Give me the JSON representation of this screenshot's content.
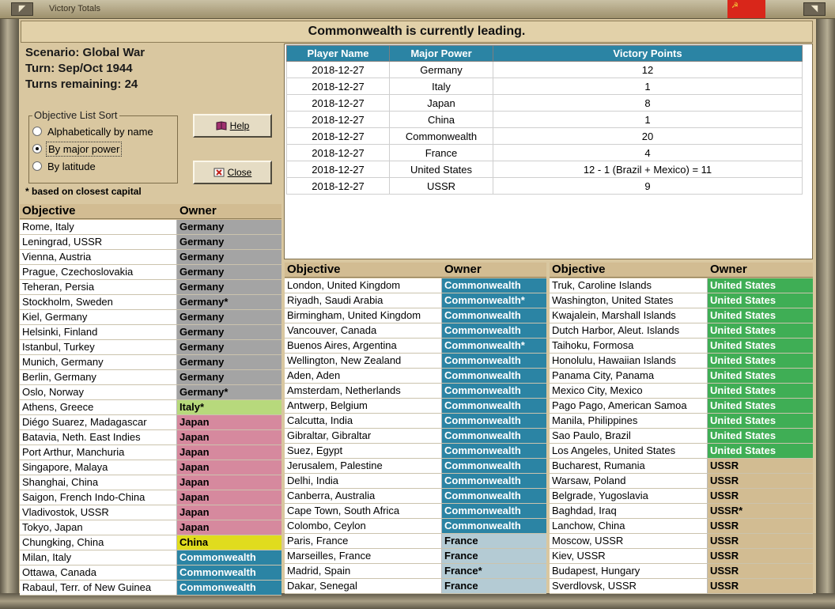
{
  "window": {
    "title": "Victory Totals"
  },
  "header": {
    "text": "Commonwealth is currently leading."
  },
  "info": {
    "scenario": "Scenario: Global War",
    "turn": "Turn: Sep/Oct 1944",
    "turns_remaining": "Turns remaining: 24"
  },
  "sort": {
    "legend": "Objective List Sort",
    "options": [
      "Alphabetically by name",
      "By major power",
      "By latitude"
    ],
    "selected_index": 1
  },
  "buttons": {
    "help": "Help",
    "close": "Close"
  },
  "footnote": "* based on closest capital",
  "vp_table": {
    "headers": [
      "Player Name",
      "Major Power",
      "Victory Points"
    ],
    "rows": [
      [
        "2018-12-27",
        "Germany",
        "12"
      ],
      [
        "2018-12-27",
        "Italy",
        "1"
      ],
      [
        "2018-12-27",
        "Japan",
        "8"
      ],
      [
        "2018-12-27",
        "China",
        "1"
      ],
      [
        "2018-12-27",
        "Commonwealth",
        "20"
      ],
      [
        "2018-12-27",
        "France",
        "4"
      ],
      [
        "2018-12-27",
        "United States",
        "12 - 1 (Brazil + Mexico) = 11"
      ],
      [
        "2018-12-27",
        "USSR",
        "9"
      ]
    ]
  },
  "colors": {
    "Germany": "#a4a4a4",
    "Italy": "#b7d97c",
    "Japan": "#d6899e",
    "China": "#e0dc1e",
    "Commonwealth": "#2b84a4",
    "France": "#b4cbd4",
    "United States": "#3fae55",
    "USSR": "#d2bc92"
  },
  "lists": {
    "headers": {
      "objective": "Objective",
      "owner": "Owner"
    },
    "col1": [
      [
        "Rome, Italy",
        "Germany",
        "Germany"
      ],
      [
        "Leningrad, USSR",
        "Germany",
        "Germany"
      ],
      [
        "Vienna, Austria",
        "Germany",
        "Germany"
      ],
      [
        "Prague, Czechoslovakia",
        "Germany",
        "Germany"
      ],
      [
        "Teheran, Persia",
        "Germany",
        "Germany"
      ],
      [
        "Stockholm, Sweden",
        "Germany*",
        "Germany"
      ],
      [
        "Kiel, Germany",
        "Germany",
        "Germany"
      ],
      [
        "Helsinki, Finland",
        "Germany",
        "Germany"
      ],
      [
        "Istanbul, Turkey",
        "Germany",
        "Germany"
      ],
      [
        "Munich, Germany",
        "Germany",
        "Germany"
      ],
      [
        "Berlin, Germany",
        "Germany",
        "Germany"
      ],
      [
        "Oslo, Norway",
        "Germany*",
        "Germany"
      ],
      [
        "Athens, Greece",
        "Italy*",
        "Italy"
      ],
      [
        "Diégo Suarez, Madagascar",
        "Japan",
        "Japan"
      ],
      [
        "Batavia, Neth. East Indies",
        "Japan",
        "Japan"
      ],
      [
        "Port Arthur, Manchuria",
        "Japan",
        "Japan"
      ],
      [
        "Singapore, Malaya",
        "Japan",
        "Japan"
      ],
      [
        "Shanghai, China",
        "Japan",
        "Japan"
      ],
      [
        "Saigon, French Indo-China",
        "Japan",
        "Japan"
      ],
      [
        "Vladivostok, USSR",
        "Japan",
        "Japan"
      ],
      [
        "Tokyo, Japan",
        "Japan",
        "Japan"
      ],
      [
        "Chungking, China",
        "China",
        "China"
      ],
      [
        "Milan, Italy",
        "Commonwealth",
        "Commonwealth"
      ],
      [
        "Ottawa, Canada",
        "Commonwealth",
        "Commonwealth"
      ],
      [
        "Rabaul, Terr. of New Guinea",
        "Commonwealth",
        "Commonwealth"
      ]
    ],
    "col2": [
      [
        "London, United Kingdom",
        "Commonwealth",
        "Commonwealth"
      ],
      [
        "Riyadh, Saudi Arabia",
        "Commonwealth*",
        "Commonwealth"
      ],
      [
        "Birmingham, United Kingdom",
        "Commonwealth",
        "Commonwealth"
      ],
      [
        "Vancouver, Canada",
        "Commonwealth",
        "Commonwealth"
      ],
      [
        "Buenos Aires, Argentina",
        "Commonwealth*",
        "Commonwealth"
      ],
      [
        "Wellington, New Zealand",
        "Commonwealth",
        "Commonwealth"
      ],
      [
        "Aden, Aden",
        "Commonwealth",
        "Commonwealth"
      ],
      [
        "Amsterdam, Netherlands",
        "Commonwealth",
        "Commonwealth"
      ],
      [
        "Antwerp, Belgium",
        "Commonwealth",
        "Commonwealth"
      ],
      [
        "Calcutta, India",
        "Commonwealth",
        "Commonwealth"
      ],
      [
        "Gibraltar, Gibraltar",
        "Commonwealth",
        "Commonwealth"
      ],
      [
        "Suez, Egypt",
        "Commonwealth",
        "Commonwealth"
      ],
      [
        "Jerusalem, Palestine",
        "Commonwealth",
        "Commonwealth"
      ],
      [
        "Delhi, India",
        "Commonwealth",
        "Commonwealth"
      ],
      [
        "Canberra, Australia",
        "Commonwealth",
        "Commonwealth"
      ],
      [
        "Cape Town, South Africa",
        "Commonwealth",
        "Commonwealth"
      ],
      [
        "Colombo, Ceylon",
        "Commonwealth",
        "Commonwealth"
      ],
      [
        "Paris, France",
        "France",
        "France"
      ],
      [
        "Marseilles, France",
        "France",
        "France"
      ],
      [
        "Madrid, Spain",
        "France*",
        "France"
      ],
      [
        "Dakar, Senegal",
        "France",
        "France"
      ]
    ],
    "col3": [
      [
        "Truk, Caroline Islands",
        "United States",
        "United States"
      ],
      [
        "Washington, United States",
        "United States",
        "United States"
      ],
      [
        "Kwajalein, Marshall Islands",
        "United States",
        "United States"
      ],
      [
        "Dutch Harbor, Aleut. Islands",
        "United States",
        "United States"
      ],
      [
        "Taihoku, Formosa",
        "United States",
        "United States"
      ],
      [
        "Honolulu, Hawaiian Islands",
        "United States",
        "United States"
      ],
      [
        "Panama City, Panama",
        "United States",
        "United States"
      ],
      [
        "Mexico City, Mexico",
        "United States",
        "United States"
      ],
      [
        "Pago Pago, American Samoa",
        "United States",
        "United States"
      ],
      [
        "Manila, Philippines",
        "United States",
        "United States"
      ],
      [
        "Sao Paulo, Brazil",
        "United States",
        "United States"
      ],
      [
        "Los Angeles, United States",
        "United States",
        "United States"
      ],
      [
        "Bucharest, Rumania",
        "USSR",
        "USSR"
      ],
      [
        "Warsaw, Poland",
        "USSR",
        "USSR"
      ],
      [
        "Belgrade, Yugoslavia",
        "USSR",
        "USSR"
      ],
      [
        "Baghdad, Iraq",
        "USSR*",
        "USSR"
      ],
      [
        "Lanchow, China",
        "USSR",
        "USSR"
      ],
      [
        "Moscow, USSR",
        "USSR",
        "USSR"
      ],
      [
        "Kiev, USSR",
        "USSR",
        "USSR"
      ],
      [
        "Budapest, Hungary",
        "USSR",
        "USSR"
      ],
      [
        "Sverdlovsk, USSR",
        "USSR",
        "USSR"
      ]
    ]
  }
}
